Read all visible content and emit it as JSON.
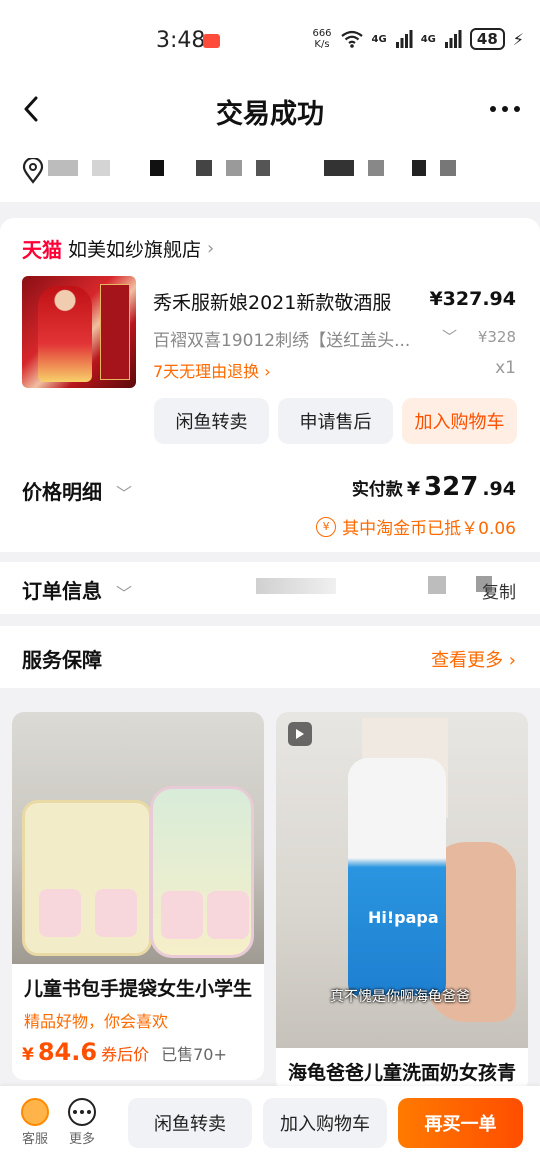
{
  "status": {
    "time": "3:48",
    "net_speed_value": "666",
    "net_speed_unit": "K/s",
    "signal1": "4G",
    "signal2": "4G",
    "battery": "48"
  },
  "header": {
    "title": "交易成功"
  },
  "shop": {
    "platform": "天猫",
    "name": "如美如纱旗舰店",
    "chevron": "›"
  },
  "product": {
    "title": "秀禾服新娘2021新款敬酒服",
    "price": "¥327.94",
    "sku": "百褶双喜19012刺绣【送红盖头...",
    "original_price": "¥328",
    "return_policy": "7天无理由退换 ›",
    "quantity": "x1"
  },
  "actions": {
    "resell": "闲鱼转卖",
    "after_sale": "申请售后",
    "add_cart": "加入购物车"
  },
  "price_detail": {
    "label": "价格明细",
    "paid_label": "实付款",
    "paid_yen": "¥",
    "paid_amount": "327",
    "paid_decimal": ".94",
    "coin_text": "其中淘金币已抵￥0.06",
    "coin_icon": "¥"
  },
  "order_info": {
    "label": "订单信息",
    "copy": "复制"
  },
  "service": {
    "label": "服务保障",
    "see_more": "查看更多 ›"
  },
  "recommend": [
    {
      "title": "儿童书包手提袋女生小学生",
      "subtitle": "精品好物，你会喜欢",
      "price_yen": "¥",
      "price": "84.6",
      "price_tag": "券后价",
      "sold": "已售70+"
    },
    {
      "title": "海龟爸爸儿童洗面奶女孩青",
      "caption": "真不愧是你啊海龟爸爸",
      "bottle_label": "Hi!papa"
    }
  ],
  "bottom_bar": {
    "service": "客服",
    "more": "更多",
    "resell": "闲鱼转卖",
    "add_cart": "加入购物车",
    "buy_again": "再买一单"
  },
  "colors": {
    "accent": "#ff5000",
    "tmall": "#ff0036",
    "orange_text": "#ff6a00"
  }
}
